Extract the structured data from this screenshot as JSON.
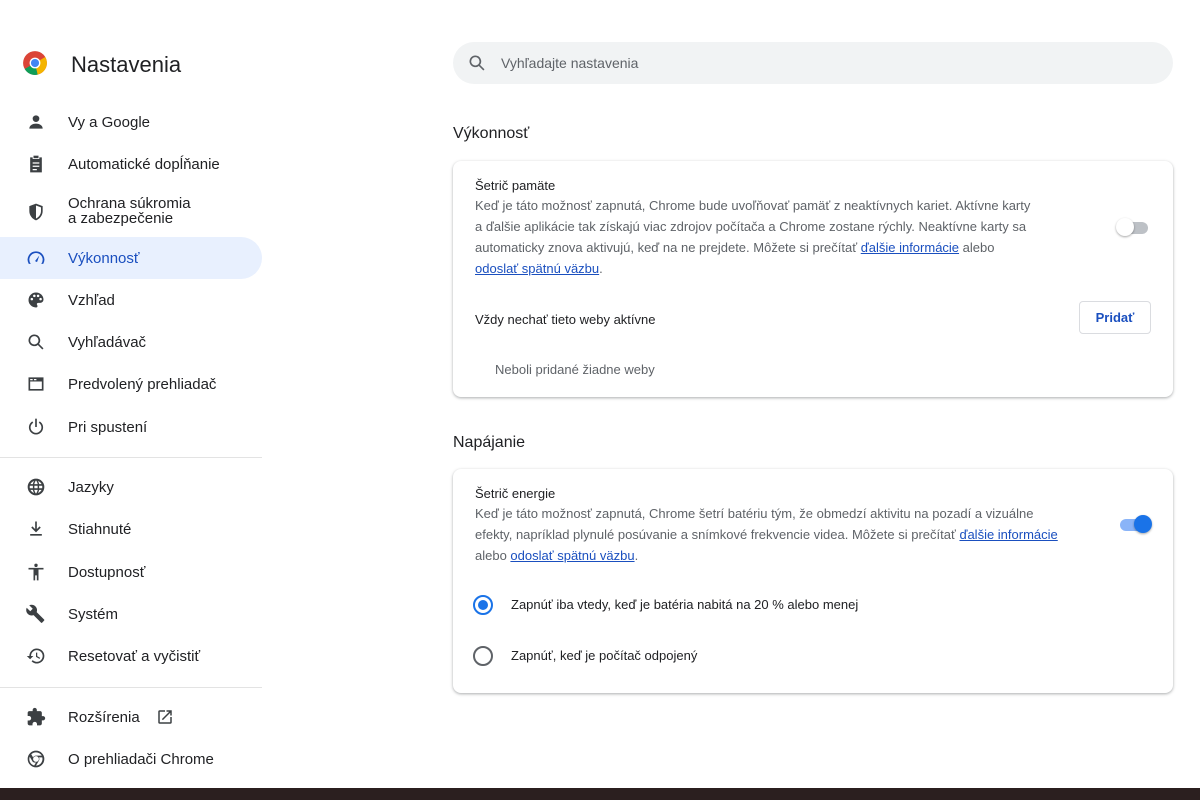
{
  "sidebar": {
    "title": "Nastavenia",
    "items": [
      {
        "label": "Vy a Google",
        "icon": "person-icon"
      },
      {
        "label": "Automatické dopĺňanie",
        "icon": "clipboard-icon"
      },
      {
        "label_line1": "Ochrana súkromia",
        "label_line2": "a zabezpečenie",
        "icon": "shield-icon"
      },
      {
        "label": "Výkonnosť",
        "icon": "speedometer-icon",
        "active": true
      },
      {
        "label": "Vzhľad",
        "icon": "palette-icon"
      },
      {
        "label": "Vyhľadávač",
        "icon": "search-icon"
      },
      {
        "label": "Predvolený prehliadač",
        "icon": "browser-window-icon"
      },
      {
        "label": "Pri spustení",
        "icon": "power-icon"
      },
      {
        "label": "Jazyky",
        "icon": "globe-icon"
      },
      {
        "label": "Stiahnuté",
        "icon": "download-icon"
      },
      {
        "label": "Dostupnosť",
        "icon": "accessibility-icon"
      },
      {
        "label": "Systém",
        "icon": "wrench-icon"
      },
      {
        "label": "Resetovať a vyčistiť",
        "icon": "restore-icon"
      },
      {
        "label": "Rozšírenia",
        "icon": "puzzle-icon"
      },
      {
        "label": "O prehliadači Chrome",
        "icon": "chrome-icon"
      }
    ]
  },
  "search": {
    "placeholder": "Vyhľadajte nastavenia"
  },
  "performance": {
    "section_title": "Výkonnosť",
    "memory_saver": {
      "title": "Šetrič pamäte",
      "desc_line1": "Keď je táto možnosť zapnutá, Chrome bude uvoľňovať pamäť z neaktívnych kariet. Aktívne karty",
      "desc_line2": "a ďalšie aplikácie tak získajú viac zdrojov počítača a Chrome zostane rýchly. Neaktívne karty sa",
      "desc_line3_prefix": "automaticky znova aktivujú, keď na ne prejdete. Môžete si prečítať ",
      "learn_more_link": "ďalšie informácie",
      "desc_line3_suffix": " alebo",
      "feedback_link": "odoslať spätnú väzbu",
      "desc_end": ".",
      "enabled": false
    },
    "always_active": {
      "label": "Vždy nechať tieto weby aktívne",
      "add_button": "Pridať",
      "empty_text": "Neboli pridané žiadne weby"
    }
  },
  "power": {
    "section_title": "Napájanie",
    "energy_saver": {
      "title": "Šetrič energie",
      "desc_line1": "Keď je táto možnosť zapnutá, Chrome šetrí batériu tým, že obmedzí aktivitu na pozadí a vizuálne",
      "desc_line2_prefix": "efekty, napríklad plynulé posúvanie a snímkové frekvencie videa. Môžete si prečítať ",
      "learn_more_link": "ďalšie informácie",
      "desc_line3_prefix": "alebo ",
      "feedback_link": "odoslať spätnú väzbu",
      "desc_end": ".",
      "enabled": true
    },
    "options": [
      {
        "label": "Zapnúť iba vtedy, keď je batéria nabitá na 20 % alebo menej",
        "checked": true
      },
      {
        "label": "Zapnúť, keď je počítač odpojený",
        "checked": false
      }
    ]
  },
  "colors": {
    "accent": "#1a73e8",
    "active_nav_bg": "#e8f0fe",
    "link": "#1a4fbf"
  }
}
